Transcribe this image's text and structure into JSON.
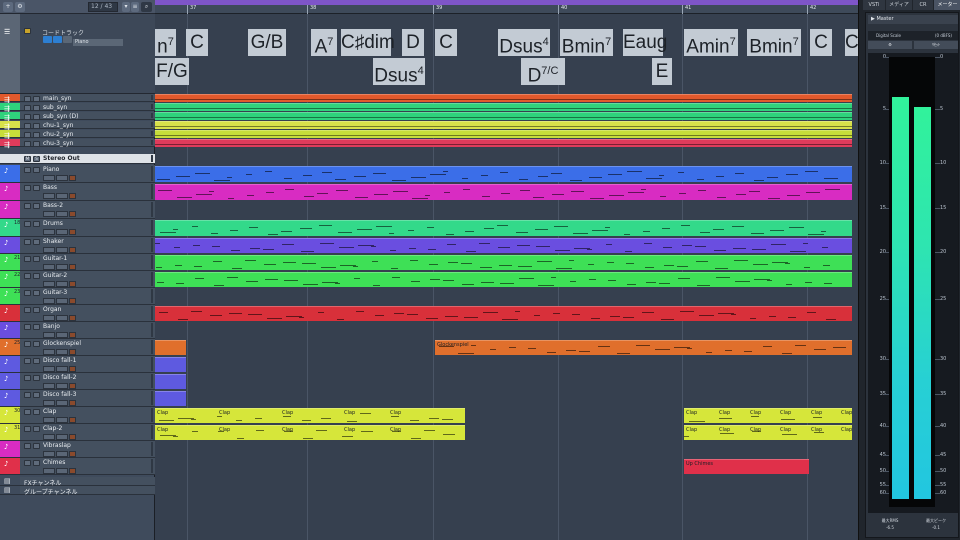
{
  "toolbar": {
    "counter": "12 / 43",
    "btn_a": "ヲ",
    "btn_b": "タイプ",
    "btn_c": "ボイ"
  },
  "chord_track": {
    "label": "コードトラック",
    "track_name": "Piano",
    "chords_top": [
      {
        "root": "n",
        "ext": "7"
      },
      {
        "root": "C",
        "ext": ""
      },
      {
        "root": "G/B",
        "ext": ""
      },
      {
        "root": "A",
        "ext": "7"
      },
      {
        "root": "C♯dim",
        "ext": ""
      },
      {
        "root": "D",
        "ext": ""
      },
      {
        "root": "C",
        "ext": ""
      },
      {
        "root": "Dsus",
        "ext": "4"
      },
      {
        "root": "Bmin",
        "ext": "7"
      },
      {
        "root": "Eaug",
        "ext": ""
      },
      {
        "root": "Amin",
        "ext": "7"
      },
      {
        "root": "Bmin",
        "ext": "7"
      },
      {
        "root": "C",
        "ext": ""
      },
      {
        "root": "C",
        "ext": ""
      }
    ],
    "chords_bottom": [
      {
        "root": "F/G",
        "ext": ""
      },
      {
        "root": "Dsus",
        "ext": "4"
      },
      {
        "root": "D",
        "ext": "7/C"
      },
      {
        "root": "E",
        "ext": ""
      }
    ]
  },
  "ruler": {
    "bars": [
      "37",
      "38",
      "39",
      "40",
      "41",
      "42"
    ]
  },
  "tracks": [
    {
      "name": "main_syn",
      "num": "",
      "color": "#e2592c"
    },
    {
      "name": "sub_syn",
      "num": "",
      "color": "#2fd27c"
    },
    {
      "name": "sub_syn (D)",
      "num": "",
      "color": "#2fd27c"
    },
    {
      "name": "chu-1_syn",
      "num": "",
      "color": "#d8e04a"
    },
    {
      "name": "chu-2_syn",
      "num": "",
      "color": "#c7dd3a"
    },
    {
      "name": "chu-3_syn",
      "num": "",
      "color": "#df3b5b"
    },
    {
      "name": "Stereo Out",
      "num": "",
      "color": "#dfe3e8"
    },
    {
      "name": "Piano",
      "num": "",
      "color": "#3b6ee8"
    },
    {
      "name": "Bass",
      "num": "",
      "color": "#d82cc2"
    },
    {
      "name": "Bass-2",
      "num": "",
      "color": "#d82cc2"
    },
    {
      "name": "Drums",
      "num": "18",
      "color": "#33d98a"
    },
    {
      "name": "Shaker",
      "num": "",
      "color": "#6a4ee0"
    },
    {
      "name": "Guitar-1",
      "num": "21",
      "color": "#3ee056"
    },
    {
      "name": "Guitar-2",
      "num": "22",
      "color": "#3ee056"
    },
    {
      "name": "Guitar-3",
      "num": "23",
      "color": "#3ee056"
    },
    {
      "name": "Organ",
      "num": "",
      "color": "#d8303a"
    },
    {
      "name": "Banjo",
      "num": "",
      "color": "#6a4ee0"
    },
    {
      "name": "Glockenspiel",
      "num": "25",
      "color": "#e06f2c"
    },
    {
      "name": "Disco fall-1",
      "num": "",
      "color": "#5e5ae0"
    },
    {
      "name": "Disco fall-2",
      "num": "",
      "color": "#5e5ae0"
    },
    {
      "name": "Disco fall-3",
      "num": "",
      "color": "#5e5ae0"
    },
    {
      "name": "Clap",
      "num": "30",
      "color": "#d6e63a"
    },
    {
      "name": "Clap-2",
      "num": "31",
      "color": "#d6e63a"
    },
    {
      "name": "Vibraslap",
      "num": "",
      "color": "#d82cc2"
    },
    {
      "name": "Chimes",
      "num": "",
      "color": "#e0304a"
    },
    {
      "name": "FXチャンネル",
      "num": "",
      "color": ""
    },
    {
      "name": "グループチャンネル",
      "num": "",
      "color": ""
    }
  ],
  "parts": {
    "glock_label": "Glockenspiel",
    "clap_label": "Clap",
    "chimes_label": "Up Chimes"
  },
  "rightzone": {
    "tabs": [
      "VSTi",
      "メディア",
      "CR",
      "メーター"
    ],
    "panel_title": "Master",
    "scale_label": "Digital Scale",
    "scale_value": "(0 dBFS)",
    "btn_left": "⚙",
    "btn_right": "ﾘｾｯﾄ",
    "scale": [
      "0",
      "5",
      "10",
      "15",
      "20",
      "25",
      "30",
      "35",
      "40",
      "45",
      "50",
      "55",
      "60"
    ],
    "level_left_db": -2.5,
    "level_right_db": -3.5,
    "rms_label": "最大RMS",
    "rms_value": "-6.5",
    "peak_label": "最大ピーク",
    "peak_value": "-0.1"
  }
}
